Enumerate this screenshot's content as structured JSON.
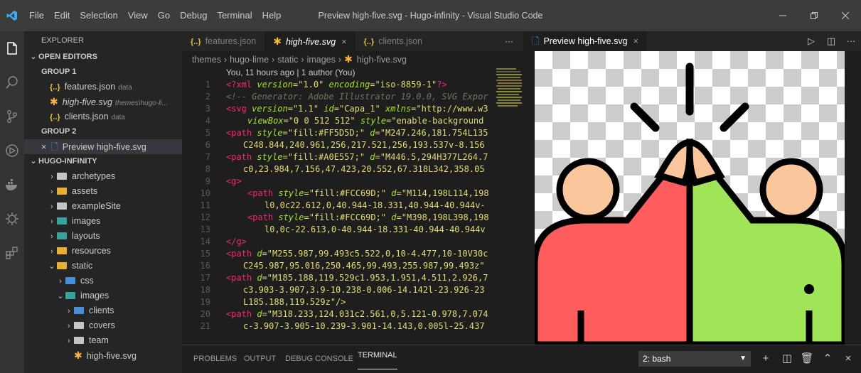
{
  "window": {
    "title": "Preview high-five.svg - Hugo-infinity - Visual Studio Code",
    "menu": [
      "File",
      "Edit",
      "Selection",
      "View",
      "Go",
      "Debug",
      "Terminal",
      "Help"
    ]
  },
  "sidebar": {
    "title": "EXPLORER",
    "open_editors_label": "OPEN EDITORS",
    "group1_label": "GROUP 1",
    "group1_items": [
      {
        "name": "features.json",
        "hint": "data"
      },
      {
        "name": "high-five.svg",
        "hint": "themes\\hugo-li..."
      },
      {
        "name": "clients.json",
        "hint": "data"
      }
    ],
    "group2_label": "GROUP 2",
    "group2_items": [
      {
        "name": "Preview high-five.svg"
      }
    ],
    "project_label": "HUGO-INFINITY",
    "tree": [
      {
        "name": "archetypes",
        "color": "#c5c5c5"
      },
      {
        "name": "assets",
        "color": "#e8b02e"
      },
      {
        "name": "exampleSite",
        "color": "#c5c5c5"
      },
      {
        "name": "images",
        "color": "#37a39a"
      },
      {
        "name": "layouts",
        "color": "#37a39a"
      },
      {
        "name": "resources",
        "color": "#e8b02e"
      },
      {
        "name": "static",
        "color": "#e8b02e"
      },
      {
        "name": "css",
        "color": "#4a90d9"
      },
      {
        "name": "images",
        "color": "#37a39a"
      },
      {
        "name": "clients",
        "color": "#4a90d9"
      },
      {
        "name": "covers",
        "color": "#c5c5c5"
      },
      {
        "name": "team",
        "color": "#c5c5c5"
      },
      {
        "name": "high-five.svg",
        "color": "#ffb13b"
      }
    ]
  },
  "editor": {
    "tabs": [
      "features.json",
      "high-five.svg",
      "clients.json"
    ],
    "more": "···",
    "breadcrumb": [
      "themes",
      "hugo-lime",
      "static",
      "images",
      "high-five.svg"
    ],
    "blame": "You, 11 hours ago | 1 author (You)",
    "line_numbers": [
      "1",
      "2",
      "3",
      "4",
      "5",
      "6",
      "7",
      "8",
      "9",
      "10",
      "11",
      "12",
      "13",
      "14",
      "15",
      "16",
      "17",
      "18",
      "19",
      "20",
      "21"
    ]
  },
  "code": {
    "l1_a": "<?",
    "l1_b": "xml",
    "l1_c": " version",
    "l1_d": "=\"1.0\"",
    "l1_e": " encoding",
    "l1_f": "=\"iso-8859-1\"",
    "l1_g": "?>",
    "l2": "<!-- Generator: Adobe Illustrator 19.0.0, SVG Expor",
    "l3_a": "<svg",
    "l3_b": " version",
    "l3_c": "=\"1.1\"",
    "l3_d": " id",
    "l3_e": "=\"Capa_1\"",
    "l3_f": " xmlns",
    "l3_g": "=\"http://www.w3",
    "l4_a": "viewBox",
    "l4_b": "=\"0 0 512 512\"",
    "l4_c": " style",
    "l4_d": "=\"enable-background",
    "l5_a": "<path",
    "l5_b": " style",
    "l5_c": "=\"fill:#FF5D5D;\"",
    "l5_d": " d",
    "l5_e": "=\"M247.246,181.754L135",
    "l6": "C248.844,240.961,256,217.521,256,193.537v-8.156",
    "l7_a": "<path",
    "l7_b": " style",
    "l7_c": "=\"fill:#A0E557;\"",
    "l7_d": " d",
    "l7_e": "=\"M446.5,294H377L264.7",
    "l8": "c0,23.984,7.156,47.423,20.552,67.318L342,358.05",
    "l9": "<g>",
    "l10_a": "<path",
    "l10_b": " style",
    "l10_c": "=\"fill:#FCC69D;\"",
    "l10_d": " d",
    "l10_e": "=\"M114,198L114,198",
    "l11": "l0,0c22.612,0,40.944-18.331,40.944-40.944v-",
    "l12_a": "<path",
    "l12_b": " style",
    "l12_c": "=\"fill:#FCC69D;\"",
    "l12_d": " d",
    "l12_e": "=\"M398,198L398,198",
    "l13": "l0,0c-22.613,0-40.944-18.331-40.944-40.944v",
    "l14": "</g>",
    "l15_a": "<path",
    "l15_b": " d",
    "l15_c": "=\"M255.987,99.493c5.522,0,10-4.477,10-10V30c",
    "l16": "C245.987,95.016,250.465,99.493,255.987,99.493z\"",
    "l17_a": "<path",
    "l17_b": " d",
    "l17_c": "=\"M185.188,119.529c1.953,1.951,4.511,2.926,7",
    "l18": "c3.903-3.907,3.9-10.238-0.006-14.142l-23.926-23",
    "l19": "L185.188,119.529z\"/>",
    "l20_a": "<path",
    "l20_b": " d",
    "l20_c": "=\"M318.233,124.031c2.561,0,5.121-0.978,7.074",
    "l21": "c-3.907-3.905-10.239-3.901-14.143,0.005l-25.437"
  },
  "preview": {
    "tab_label": "Preview high-five.svg",
    "colors": {
      "red_shirt": "#FF5D5D",
      "green_shirt": "#A0E557",
      "skin": "#FCC69D",
      "outline": "#000000"
    }
  },
  "panel": {
    "tabs": [
      "PROBLEMS",
      "OUTPUT",
      "DEBUG CONSOLE",
      "TERMINAL"
    ],
    "active_tab": "TERMINAL",
    "terminal_select": "2: bash"
  }
}
